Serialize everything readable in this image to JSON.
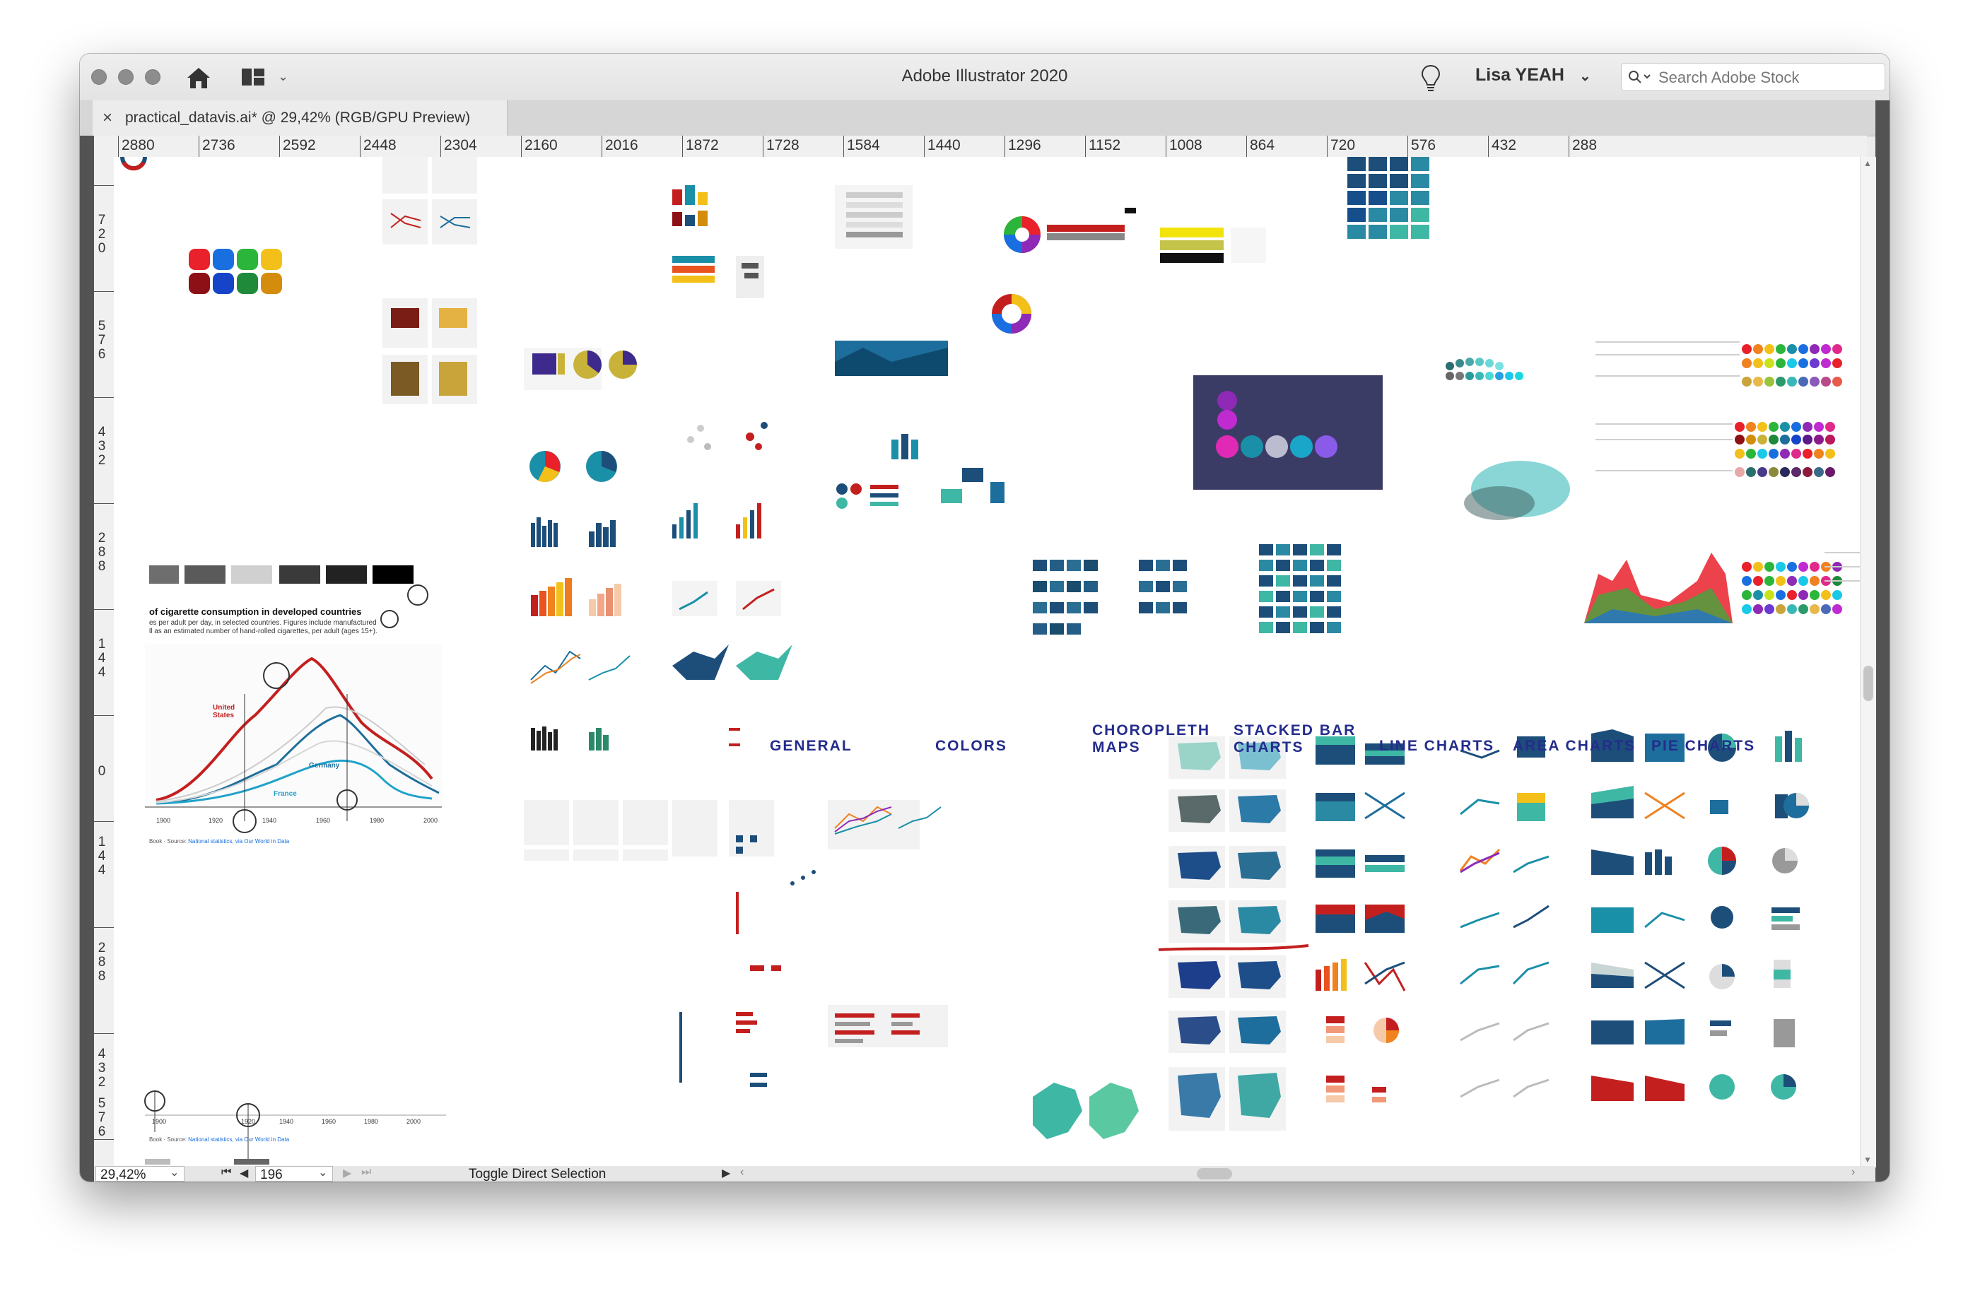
{
  "app": {
    "title": "Adobe Illustrator 2020",
    "user": "Lisa YEAH",
    "search_placeholder": "Search Adobe Stock"
  },
  "document": {
    "tab_label": "practical_datavis.ai* @ 29,42% (RGB/GPU Preview)",
    "close": "×"
  },
  "ruler": {
    "horizontal": [
      "2880",
      "2736",
      "2592",
      "2448",
      "2304",
      "2160",
      "2016",
      "1872",
      "1728",
      "1584",
      "1440",
      "1296",
      "1152",
      "1008",
      "864",
      "720",
      "576",
      "432",
      "288"
    ],
    "vertical": [
      "720",
      "576",
      "432",
      "288",
      "144",
      "0",
      "144",
      "288",
      "432",
      "576"
    ]
  },
  "artboard": {
    "sections": [
      "GENERAL",
      "COLORS",
      "CHOROPLETH MAPS",
      "STACKED BAR CHARTS",
      "LINE CHARTS",
      "AREA CHARTS",
      "PIE CHARTS"
    ],
    "cig_chart": {
      "title": "of cigarette consumption in developed countries",
      "subtitle1": "es per adult per day, in selected countries. Figures include manufactured",
      "subtitle2": "ll as an estimated number of hand-rolled cigarettes, per adult (ages 15+).",
      "series": [
        "United States",
        "Germany",
        "France"
      ],
      "x_ticks": [
        "1900",
        "1920",
        "1940",
        "1960",
        "1980",
        "2000"
      ],
      "source_prefix": "Book · Source: ",
      "source_link": "National statistics, via Our World in Data"
    }
  },
  "status": {
    "zoom": "29,42%",
    "artboard_number": "196",
    "tool": "Toggle Direct Selection"
  },
  "colors": {
    "section_title": "#242c8c",
    "teal": "#1a8fa8",
    "navy": "#1d4e7a",
    "red_underline": "#c41f1f",
    "dark_panel": "#3b3c66"
  },
  "icons": [
    "home-icon",
    "layout-icon",
    "lightbulb-icon",
    "search-icon",
    "close-icon",
    "first-page-icon",
    "prev-page-icon",
    "next-page-icon",
    "last-page-icon"
  ]
}
